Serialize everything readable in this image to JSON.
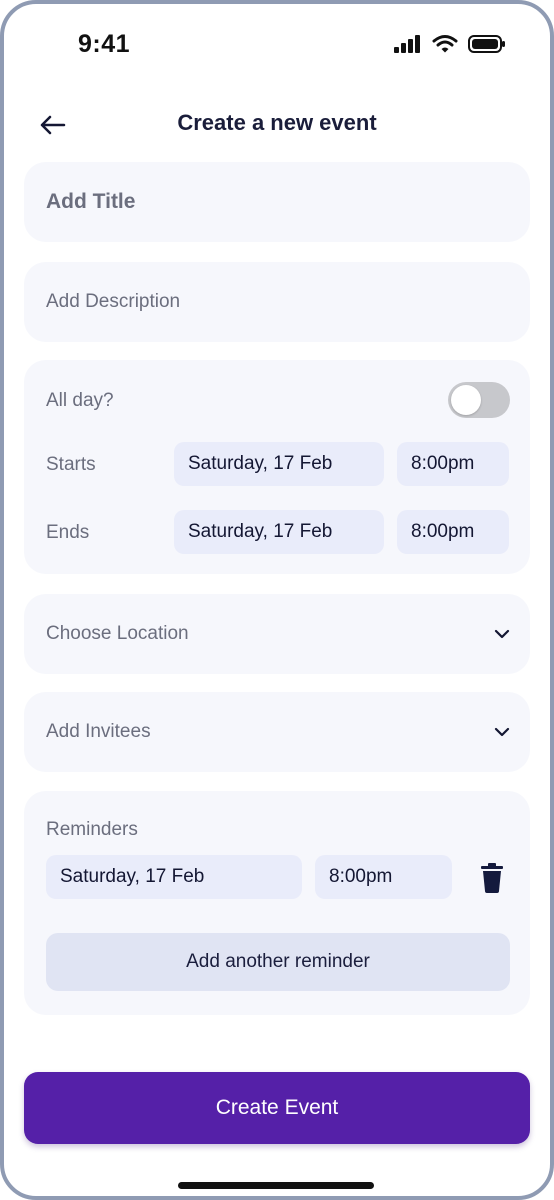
{
  "status_bar": {
    "time": "9:41"
  },
  "header": {
    "title": "Create a new event"
  },
  "form": {
    "title_placeholder": "Add Title",
    "description_placeholder": "Add Description",
    "schedule": {
      "all_day_label": "All day?",
      "all_day_on": false,
      "starts_label": "Starts",
      "starts_date": "Saturday, 17 Feb",
      "starts_time": "8:00pm",
      "ends_label": "Ends",
      "ends_date": "Saturday, 17 Feb",
      "ends_time": "8:00pm"
    },
    "location_label": "Choose Location",
    "invitees_label": "Add Invitees",
    "reminders": {
      "label": "Reminders",
      "items": [
        {
          "date": "Saturday, 17 Feb",
          "time": "8:00pm"
        }
      ],
      "add_label": "Add another reminder"
    }
  },
  "create_button": {
    "label": "Create Event"
  },
  "colors": {
    "primary": "#5520a8",
    "card_bg": "#f6f7fc",
    "field_bg": "#e9ecfa"
  }
}
